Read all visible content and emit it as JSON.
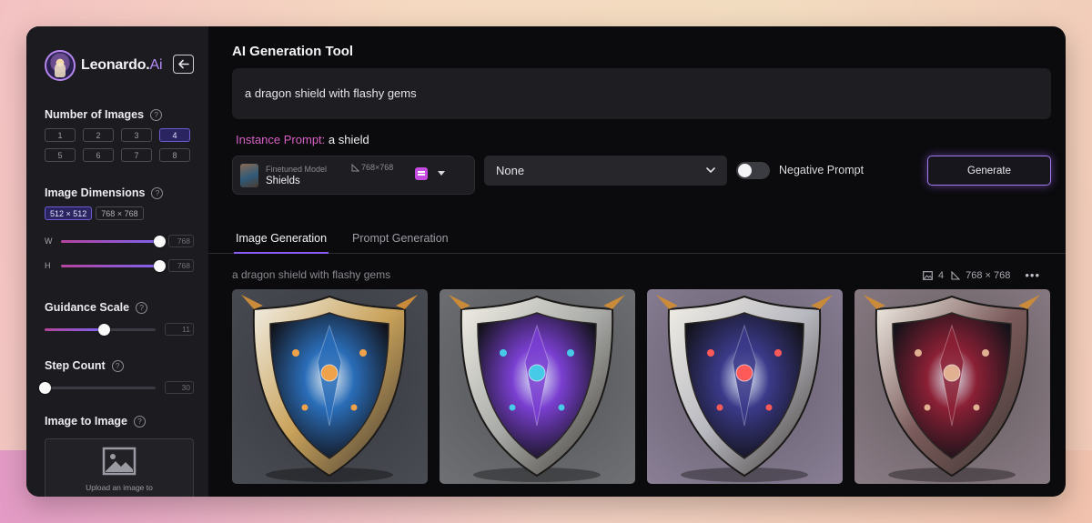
{
  "sidebar": {
    "brand": {
      "name": "Leonardo.",
      "suffix": "Ai"
    },
    "number_of_images": {
      "title": "Number of Images",
      "options": [
        "1",
        "2",
        "3",
        "4",
        "5",
        "6",
        "7",
        "8"
      ],
      "selected": "4"
    },
    "image_dimensions": {
      "title": "Image Dimensions",
      "presets": [
        "512 × 512",
        "768 × 768"
      ],
      "selected": "512 × 512",
      "width_label": "W",
      "width_value": "768",
      "height_label": "H",
      "height_value": "768"
    },
    "guidance_scale": {
      "title": "Guidance Scale",
      "value": "11"
    },
    "step_count": {
      "title": "Step Count",
      "value": "30"
    },
    "image_to_image": {
      "title": "Image to Image",
      "upload_text": "Upload an image to"
    }
  },
  "main": {
    "title": "AI Generation Tool",
    "prompt": "a dragon shield with flashy gems",
    "instance_prompt": {
      "label": "Instance Prompt:",
      "value": " a shield"
    },
    "model": {
      "label": "Finetuned Model",
      "name": "Shields",
      "dims": "768×768"
    },
    "style_select": {
      "value": "None"
    },
    "negative_prompt": {
      "label": "Negative Prompt",
      "enabled": false
    },
    "generate_label": "Generate",
    "tabs": [
      "Image Generation",
      "Prompt Generation"
    ],
    "active_tab": "Image Generation",
    "generation": {
      "prompt": "a dragon shield with flashy gems",
      "count": "4",
      "dims": "768 × 768",
      "images": [
        {
          "name": "shield-blue-dragon",
          "bg": "#4a4c54",
          "rim": "#c9a25a",
          "core": "#2a6db8",
          "gem": "#f0a24a"
        },
        {
          "name": "shield-purple-gem",
          "bg": "#6f7175",
          "rim": "#a9aba8",
          "core": "#7a3fd1",
          "gem": "#47c9e8"
        },
        {
          "name": "shield-city-blue",
          "bg": "#8a7f95",
          "rim": "#b8b8c0",
          "core": "#3b3a8a",
          "gem": "#ff5a5a"
        },
        {
          "name": "shield-red-dragon",
          "bg": "#8a7c84",
          "rim": "#7a5a5a",
          "core": "#8b2035",
          "gem": "#e0b090"
        }
      ]
    }
  },
  "colors": {
    "accent": "#8b5cf6",
    "instance_label": "#d660c4",
    "selected_bg": "#2a2460"
  }
}
